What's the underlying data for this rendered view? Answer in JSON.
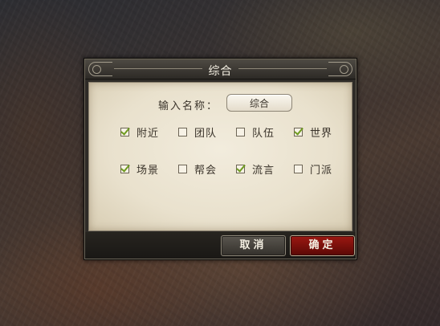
{
  "dialog": {
    "title": "综合",
    "name_label": "输入名称：",
    "name_value": "综合",
    "checkboxes": [
      {
        "label": "附近",
        "checked": true
      },
      {
        "label": "团队",
        "checked": false
      },
      {
        "label": "队伍",
        "checked": false
      },
      {
        "label": "世界",
        "checked": true
      },
      {
        "label": "场景",
        "checked": true
      },
      {
        "label": "帮会",
        "checked": false
      },
      {
        "label": "流言",
        "checked": true
      },
      {
        "label": "门派",
        "checked": false
      }
    ],
    "cancel_label": "取消",
    "confirm_label": "确定"
  },
  "colors": {
    "check_mark": "#6e9a1f",
    "confirm_button": "#9c1812",
    "parchment": "#ece5d2"
  }
}
